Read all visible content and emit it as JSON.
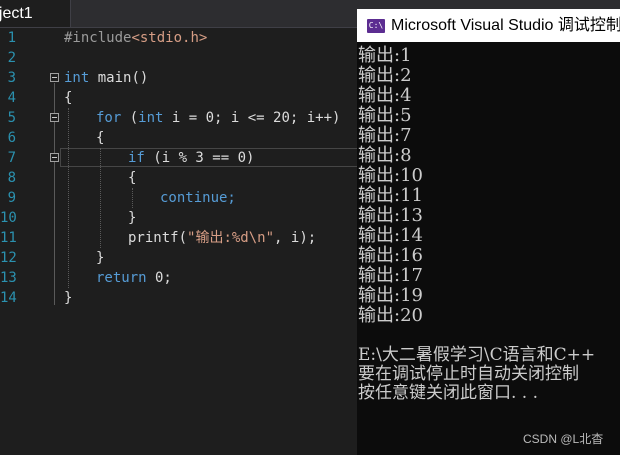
{
  "editor": {
    "tab_label": "oject1",
    "lines": [
      {
        "num": "1"
      },
      {
        "num": "2"
      },
      {
        "num": "3"
      },
      {
        "num": "4"
      },
      {
        "num": "5"
      },
      {
        "num": "6"
      },
      {
        "num": "7"
      },
      {
        "num": "8"
      },
      {
        "num": "9"
      },
      {
        "num": "10"
      },
      {
        "num": "11"
      },
      {
        "num": "12"
      },
      {
        "num": "13"
      },
      {
        "num": "14"
      }
    ],
    "code": {
      "l1_pre": "#include",
      "l1_inc": "<stdio.h>",
      "l3_kw": "int",
      "l3_rest": " main()",
      "l4": "{",
      "l5_kw1": "for",
      "l5_a": " (",
      "l5_kw2": "int",
      "l5_b": " i = 0; i <= 20; i++)",
      "l6": "{",
      "l7_kw": "if",
      "l7_rest": " (i % 3 == 0)",
      "l8": "{",
      "l9": "continue;",
      "l10": "}",
      "l11_a": "printf(",
      "l11_str": "\"输出:%d\\n\"",
      "l11_b": ", i);",
      "l12": "}",
      "l13_kw": "return",
      "l13_rest": " 0;",
      "l14": "}"
    }
  },
  "console": {
    "title": "Microsoft Visual Studio 调试控制",
    "icon_text": "C:\\",
    "output": [
      "输出:1",
      "输出:2",
      "输出:4",
      "输出:5",
      "输出:7",
      "输出:8",
      "输出:10",
      "输出:11",
      "输出:13",
      "输出:14",
      "输出:16",
      "输出:17",
      "输出:19",
      "输出:20"
    ],
    "info": [
      "E:\\大二暑假学习\\C语言和C++",
      "要在调试停止时自动关闭控制",
      "按任意键关闭此窗口. . ."
    ]
  },
  "watermark": "CSDN @L北杳",
  "colors": {
    "editor_bg": "#1e1e1e",
    "keyword": "#569cd6",
    "string": "#d69d85",
    "line_number": "#2b91af",
    "console_bg": "#0c0c0c",
    "console_text": "#cccccc"
  }
}
